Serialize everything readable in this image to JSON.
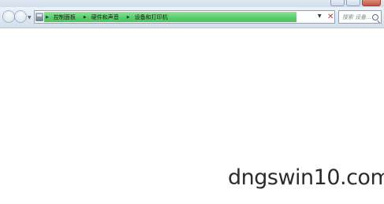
{
  "address_bar": {
    "breadcrumbs": [
      "控制面板",
      "硬件和声音",
      "设备和打印机"
    ],
    "loading_progress": 0.87,
    "progress_color": "#58cf6c"
  },
  "search": {
    "placeholder": "搜索 设备..."
  },
  "icons": {
    "back": "back-arrow-icon",
    "forward": "forward-arrow-icon",
    "location": "control-panel-icon",
    "dropdown": "chevron-down-icon",
    "stop": "close-icon",
    "search": "search-icon"
  },
  "watermark": {
    "text": "dngswin10.com"
  }
}
